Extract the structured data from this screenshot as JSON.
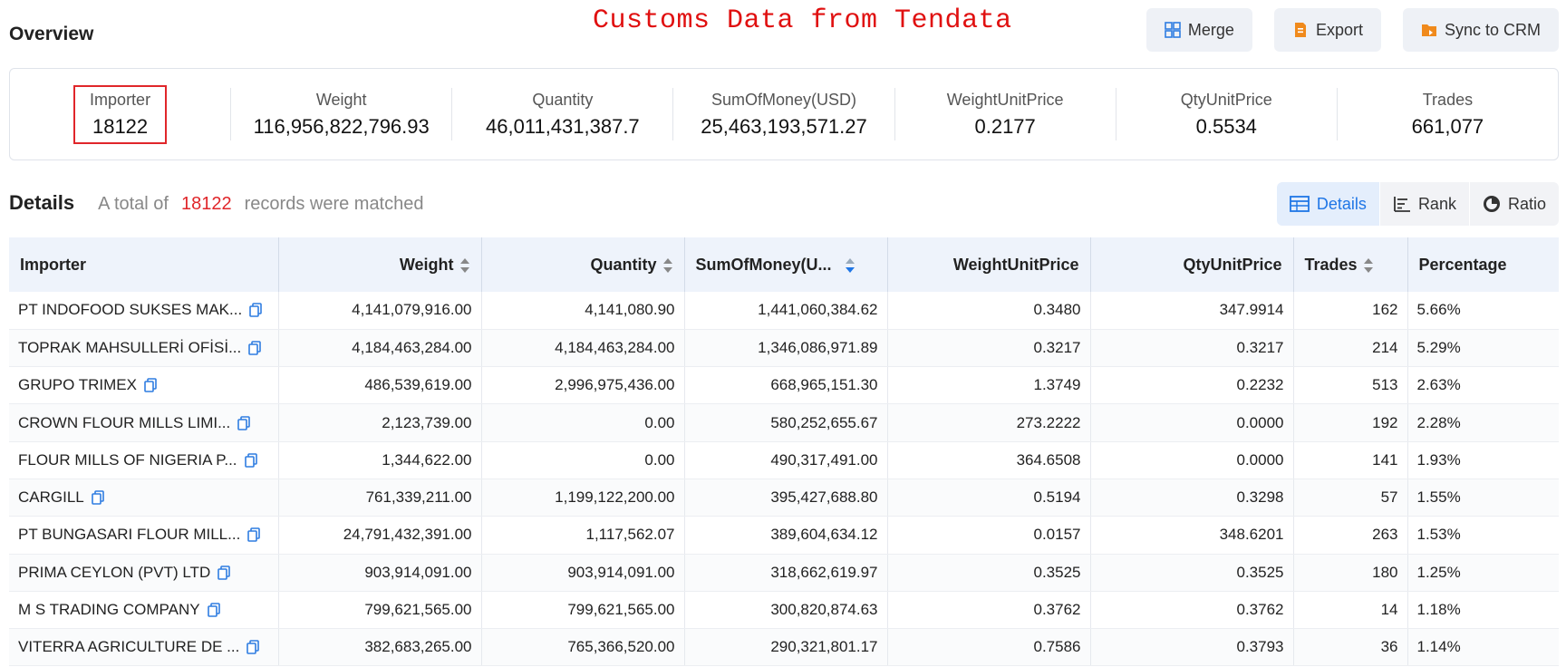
{
  "watermark": "Customs Data from Tendata",
  "overview": {
    "title": "Overview",
    "actions": [
      {
        "label": "Merge",
        "icon": "merge-icon"
      },
      {
        "label": "Export",
        "icon": "export-icon"
      },
      {
        "label": "Sync to CRM",
        "icon": "sync-crm-icon"
      }
    ],
    "stats": [
      {
        "label": "Importer",
        "value": "18122"
      },
      {
        "label": "Weight",
        "value": "116,956,822,796.93"
      },
      {
        "label": "Quantity",
        "value": "46,011,431,387.7"
      },
      {
        "label": "SumOfMoney(USD)",
        "value": "25,463,193,571.27"
      },
      {
        "label": "WeightUnitPrice",
        "value": "0.2177"
      },
      {
        "label": "QtyUnitPrice",
        "value": "0.5534"
      },
      {
        "label": "Trades",
        "value": "661,077"
      }
    ]
  },
  "details": {
    "title": "Details",
    "summary_prefix": "A total of",
    "summary_count": "18122",
    "summary_suffix": "records were matched",
    "views": [
      {
        "label": "Details",
        "icon": "table-icon"
      },
      {
        "label": "Rank",
        "icon": "rank-icon"
      },
      {
        "label": "Ratio",
        "icon": "ratio-icon"
      }
    ]
  },
  "colors": {
    "accent": "#1f76e6",
    "highlight": "#e0262a",
    "header_bg": "#eef3fb"
  },
  "table": {
    "columns": [
      "Importer",
      "Weight",
      "Quantity",
      "SumOfMoney(U...",
      "WeightUnitPrice",
      "QtyUnitPrice",
      "Trades",
      "Percentage"
    ],
    "rows": [
      [
        "PT INDOFOOD SUKSES MAK...",
        "4,141,079,916.00",
        "4,141,080.90",
        "1,441,060,384.62",
        "0.3480",
        "347.9914",
        "162",
        "5.66%"
      ],
      [
        "TOPRAK MAHSULLERİ OFİSİ...",
        "4,184,463,284.00",
        "4,184,463,284.00",
        "1,346,086,971.89",
        "0.3217",
        "0.3217",
        "214",
        "5.29%"
      ],
      [
        "GRUPO TRIMEX",
        "486,539,619.00",
        "2,996,975,436.00",
        "668,965,151.30",
        "1.3749",
        "0.2232",
        "513",
        "2.63%"
      ],
      [
        "CROWN FLOUR MILLS LIMI...",
        "2,123,739.00",
        "0.00",
        "580,252,655.67",
        "273.2222",
        "0.0000",
        "192",
        "2.28%"
      ],
      [
        "FLOUR MILLS OF NIGERIA P...",
        "1,344,622.00",
        "0.00",
        "490,317,491.00",
        "364.6508",
        "0.0000",
        "141",
        "1.93%"
      ],
      [
        "CARGILL",
        "761,339,211.00",
        "1,199,122,200.00",
        "395,427,688.80",
        "0.5194",
        "0.3298",
        "57",
        "1.55%"
      ],
      [
        "PT BUNGASARI FLOUR MILL...",
        "24,791,432,391.00",
        "1,117,562.07",
        "389,604,634.12",
        "0.0157",
        "348.6201",
        "263",
        "1.53%"
      ],
      [
        "PRIMA CEYLON (PVT) LTD",
        "903,914,091.00",
        "903,914,091.00",
        "318,662,619.97",
        "0.3525",
        "0.3525",
        "180",
        "1.25%"
      ],
      [
        "M S TRADING COMPANY",
        "799,621,565.00",
        "799,621,565.00",
        "300,820,874.63",
        "0.3762",
        "0.3762",
        "14",
        "1.18%"
      ],
      [
        "VITERRA AGRICULTURE DE ...",
        "382,683,265.00",
        "765,366,520.00",
        "290,321,801.17",
        "0.7586",
        "0.3793",
        "36",
        "1.14%"
      ]
    ]
  }
}
